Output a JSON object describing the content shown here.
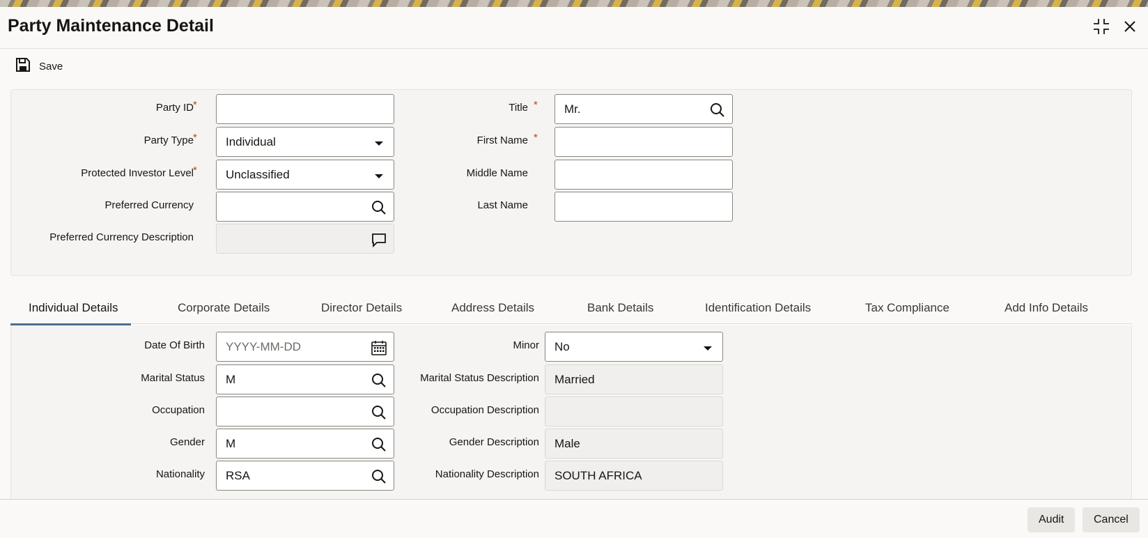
{
  "window": {
    "title": "Party Maintenance Detail",
    "minimize_icon": "collapse-icon",
    "close_icon": "close-icon"
  },
  "toolbar": {
    "save_label": "Save",
    "save_icon": "floppy-disk-icon"
  },
  "header": {
    "party_id": {
      "label": "Party ID",
      "value": ""
    },
    "party_type": {
      "label": "Party Type",
      "value": "Individual"
    },
    "protected_investor_level": {
      "label": "Protected Investor Level",
      "value": "Unclassified"
    },
    "preferred_currency": {
      "label": "Preferred Currency",
      "value": ""
    },
    "preferred_currency_description": {
      "label": "Preferred Currency Description",
      "value": ""
    },
    "title": {
      "label": "Title",
      "value": "Mr."
    },
    "first_name": {
      "label": "First Name",
      "value": ""
    },
    "middle_name": {
      "label": "Middle Name",
      "value": ""
    },
    "last_name": {
      "label": "Last Name",
      "value": ""
    },
    "required_marker": "*"
  },
  "tabs": [
    {
      "label": "Individual Details",
      "active": true
    },
    {
      "label": "Corporate Details"
    },
    {
      "label": "Director Details"
    },
    {
      "label": "Address Details"
    },
    {
      "label": "Bank Details"
    },
    {
      "label": "Identification Details"
    },
    {
      "label": "Tax Compliance"
    },
    {
      "label": "Add Info Details"
    }
  ],
  "individual": {
    "date_of_birth": {
      "label": "Date Of Birth",
      "placeholder": "YYYY-MM-DD"
    },
    "marital_status": {
      "label": "Marital Status",
      "value": "M"
    },
    "occupation": {
      "label": "Occupation",
      "value": ""
    },
    "gender": {
      "label": "Gender",
      "value": "M"
    },
    "nationality": {
      "label": "Nationality",
      "value": "RSA"
    },
    "minor": {
      "label": "Minor",
      "value": "No"
    },
    "marital_status_description": {
      "label": "Marital Status Description",
      "value": "Married"
    },
    "occupation_description": {
      "label": "Occupation Description",
      "value": ""
    },
    "gender_description": {
      "label": "Gender Description",
      "value": "Male"
    },
    "nationality_description": {
      "label": "Nationality Description",
      "value": "SOUTH AFRICA"
    }
  },
  "footer": {
    "audit_label": "Audit",
    "cancel_label": "Cancel"
  },
  "colors": {
    "accent": "#4f6e8c",
    "required": "#b4461f",
    "input_border": "#8b8782"
  }
}
